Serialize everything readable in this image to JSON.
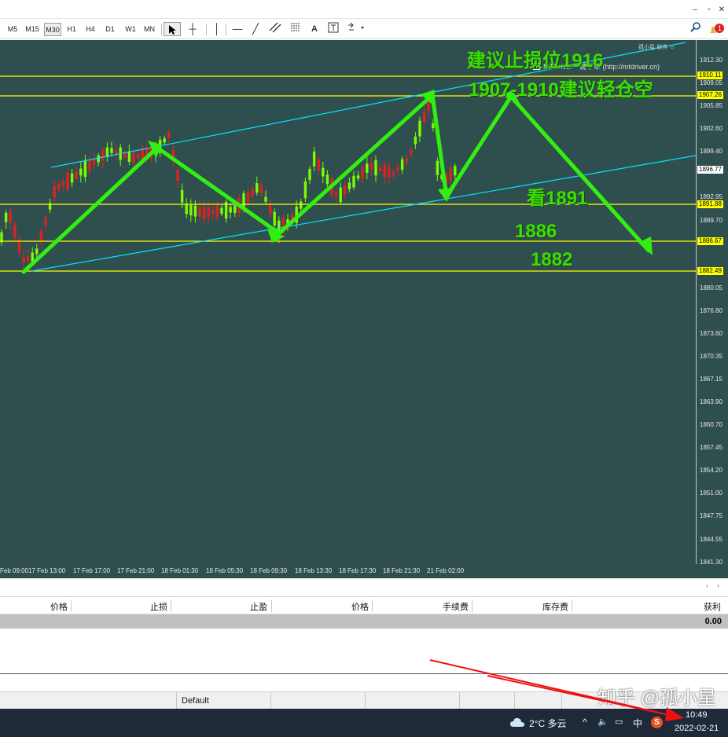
{
  "toolbar": {
    "timeframes": [
      "M5",
      "M15",
      "M30",
      "H1",
      "H4",
      "D1",
      "W1",
      "MN"
    ],
    "active_timeframe": "M30",
    "text_tool": "A"
  },
  "chart": {
    "price_ticks": [
      "1912.30",
      "1909.05",
      "1905.85",
      "1902.60",
      "1899.40",
      "1892.95",
      "1889.70",
      "1880.05",
      "1876.80",
      "1873.60",
      "1870.35",
      "1867.15",
      "1863.90",
      "1860.70",
      "1857.45",
      "1854.20",
      "1851.00",
      "1847.75",
      "1844.55",
      "1841.30"
    ],
    "time_ticks": [
      "Feb 09:00",
      "17 Feb 13:00",
      "17 Feb 17:00",
      "17 Feb 21:00",
      "18 Feb 01:30",
      "18 Feb 05:30",
      "18 Feb 09:30",
      "18 Feb 13:30",
      "18 Feb 17:30",
      "18 Feb 21:30",
      "21 Feb 02:00"
    ],
    "price_tags": [
      "1910.11",
      "1907.26",
      "1896.77",
      "1891.88",
      "1886.67",
      "1882.49"
    ],
    "current_price_tag": "1896.77",
    "ea_label": "MTDriver一键下单 (http://mtdriver.cn)",
    "corner_label": "孤小星·软件 ☺",
    "annotations": {
      "stop": "建议止损位1916",
      "short": "1907-1910建议轻仓空",
      "target_1891": "看1891",
      "target_1886": "1886",
      "target_1882": "1882"
    },
    "colors": {
      "background": "#2f4f4f",
      "level_line": "#ffff00",
      "channel": "#00e5ff",
      "arrow": "#33ee11",
      "bull_candle": "#7cfc00",
      "bear_candle": "#dd2222"
    }
  },
  "terminal": {
    "columns": [
      "价格",
      "止损",
      "止盈",
      "价格",
      "手续费",
      "库存费",
      "获利"
    ],
    "profit_total": "0.00"
  },
  "statusbar": {
    "profile": "Default"
  },
  "taskbar": {
    "weather": "2°C 多云",
    "ime": "中",
    "time": "10:49",
    "date": "2022-02-21",
    "watermark": "知乎 @孤小星"
  }
}
